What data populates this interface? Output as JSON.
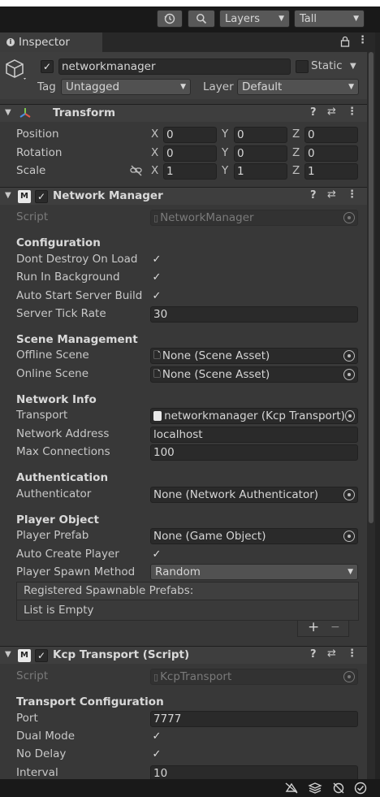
{
  "toolbar": {
    "history_icon": "history-icon",
    "search_icon": "search-icon",
    "layers_label": "Layers",
    "layout_label": "Tall"
  },
  "tab": {
    "label": "Inspector"
  },
  "gameobject": {
    "active": true,
    "name": "networkmanager",
    "static_label": "Static",
    "tag_label": "Tag",
    "tag_value": "Untagged",
    "layer_label": "Layer",
    "layer_value": "Default"
  },
  "transform": {
    "title": "Transform",
    "rows": [
      {
        "label": "Position",
        "x": "0",
        "y": "0",
        "z": "0"
      },
      {
        "label": "Rotation",
        "x": "0",
        "y": "0",
        "z": "0"
      },
      {
        "label": "Scale",
        "x": "1",
        "y": "1",
        "z": "1"
      }
    ],
    "x": "X",
    "y": "Y",
    "z": "Z"
  },
  "network_manager": {
    "title": "Network Manager",
    "script_label": "Script",
    "script_value": "NetworkManager",
    "configuration": "Configuration",
    "dont_destroy": "Dont Destroy On Load",
    "run_bg": "Run In Background",
    "auto_start": "Auto Start Server Build",
    "tick_rate_label": "Server Tick Rate",
    "tick_rate": "30",
    "scene_mgmt": "Scene Management",
    "offline_label": "Offline Scene",
    "offline_value": "None (Scene Asset)",
    "online_label": "Online Scene",
    "online_value": "None (Scene Asset)",
    "network_info": "Network Info",
    "transport_label": "Transport",
    "transport_value": "networkmanager (Kcp Transport)",
    "address_label": "Network Address",
    "address_value": "localhost",
    "maxconn_label": "Max Connections",
    "maxconn_value": "100",
    "authentication": "Authentication",
    "authenticator_label": "Authenticator",
    "authenticator_value": "None (Network Authenticator)",
    "player_object": "Player Object",
    "prefab_label": "Player Prefab",
    "prefab_value": "None (Game Object)",
    "auto_create": "Auto Create Player",
    "spawn_label": "Player Spawn Method",
    "spawn_value": "Random",
    "registered": "Registered Spawnable Prefabs:",
    "list_empty": "List is Empty",
    "plus": "+",
    "minus": "−"
  },
  "kcp": {
    "title": "Kcp Transport (Script)",
    "script_label": "Script",
    "script_value": "KcpTransport",
    "transport_config": "Transport Configuration",
    "port_label": "Port",
    "port_value": "7777",
    "dual_mode": "Dual Mode",
    "no_delay": "No Delay",
    "interval_label": "Interval",
    "interval_value": "10"
  },
  "checkmark": "✓"
}
